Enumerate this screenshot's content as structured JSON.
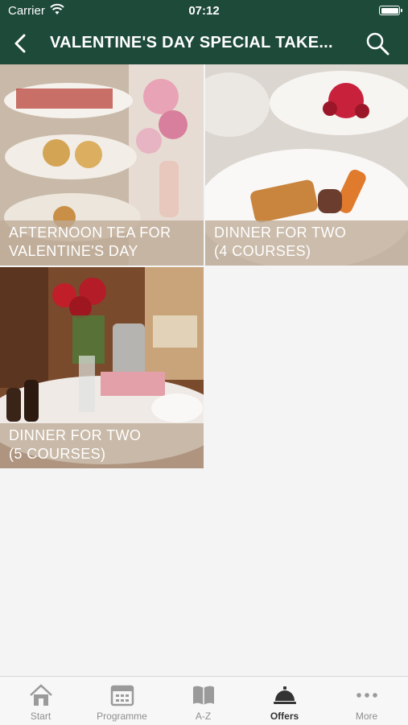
{
  "status_bar": {
    "carrier": "Carrier",
    "time": "07:12"
  },
  "nav": {
    "title": "VALENTINE'S DAY SPECIAL TAKE..."
  },
  "offers": [
    {
      "label_line1": "AFTERNOON TEA FOR",
      "label_line2": "VALENTINE'S DAY"
    },
    {
      "label_line1": "DINNER FOR TWO",
      "label_line2": "(4 COURSES)"
    },
    {
      "label_line1": "DINNER FOR TWO",
      "label_line2": "(5 COURSES)"
    }
  ],
  "tabs": [
    {
      "label": "Start",
      "icon": "house-icon"
    },
    {
      "label": "Programme",
      "icon": "calendar-icon"
    },
    {
      "label": "A-Z",
      "icon": "book-icon"
    },
    {
      "label": "Offers",
      "icon": "service-bell-icon",
      "active": true
    },
    {
      "label": "More",
      "icon": "ellipsis-icon"
    }
  ],
  "colors": {
    "header": "#1e4a3a",
    "caption_overlay": "#bea a96",
    "tab_active": "#333333",
    "tab_inactive": "#8e8e8e"
  }
}
